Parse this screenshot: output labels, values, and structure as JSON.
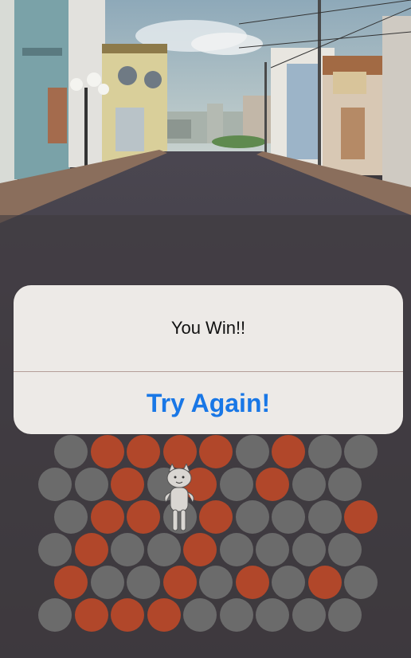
{
  "alert": {
    "message": "You Win!!",
    "button_label": "Try Again!",
    "button_color": "#1977e6"
  },
  "board": {
    "colors": {
      "gray": "#6b6b6b",
      "orange": "#b1472a"
    },
    "rows": [
      [
        "gray",
        "orange",
        "orange",
        "orange",
        "orange",
        "gray",
        "orange",
        "gray",
        "gray"
      ],
      [
        "gray",
        "gray",
        "orange",
        "gray",
        "orange",
        "gray",
        "orange",
        "gray",
        "gray"
      ],
      [
        "gray",
        "orange",
        "orange",
        "gray",
        "orange",
        "gray",
        "gray",
        "gray",
        "orange"
      ],
      [
        "gray",
        "orange",
        "gray",
        "gray",
        "orange",
        "gray",
        "gray",
        "gray",
        "gray"
      ],
      [
        "orange",
        "gray",
        "gray",
        "orange",
        "gray",
        "orange",
        "gray",
        "orange",
        "gray"
      ],
      [
        "gray",
        "orange",
        "orange",
        "orange",
        "gray",
        "gray",
        "gray",
        "gray",
        "gray"
      ]
    ],
    "cat_position": {
      "row": 1,
      "col": 3
    }
  },
  "background": {
    "scene": "street-town-illustration",
    "sky": "#9bb4c4",
    "road": "#3f3b40"
  }
}
